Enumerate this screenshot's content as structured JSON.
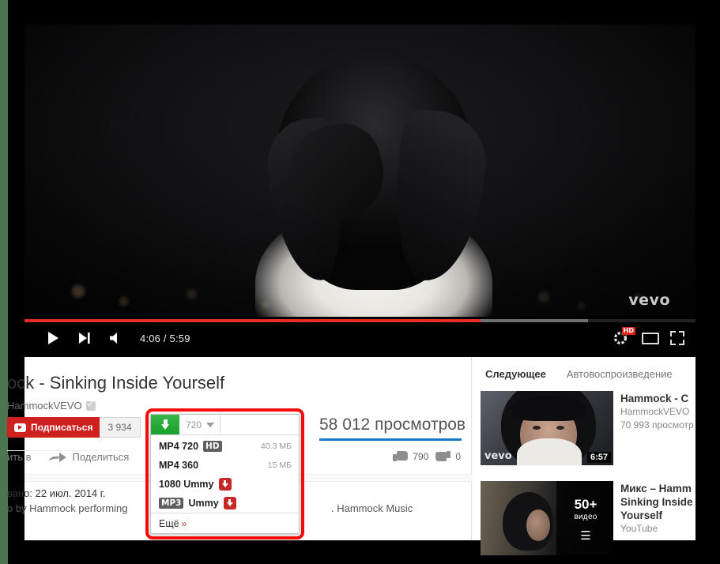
{
  "player": {
    "time_current": "4:06",
    "time_total": "5:59",
    "time_label": "4:06 / 5:59",
    "progress_played_percent": 68,
    "progress_loaded_percent": 84,
    "watermark": "vevo",
    "hd_badge": "HD",
    "icons": {
      "play": "play-icon",
      "next": "next-icon",
      "volume": "volume-icon",
      "settings": "gear-icon",
      "theater": "theater-mode-icon",
      "fullscreen": "fullscreen-icon"
    }
  },
  "video": {
    "title": "ock - Sinking Inside Yourself",
    "channel": "HammockVEVO",
    "subscribe_label": "Подписаться",
    "subscriber_count": "3 934",
    "views": "58 012 просмотров",
    "likes": "790",
    "dislikes": "0",
    "add_to_label": "ить в",
    "share_label": "Поделиться",
    "published_line": "вано: 22 июл. 2014 г.",
    "description_line": "o by Hammock performing",
    "description_line_right": ". Hammock Music"
  },
  "download_panel": {
    "selected_quality": "720",
    "items": [
      {
        "label": "MP4 720",
        "tag": "HD",
        "tag_type": "hd",
        "size": "40.3 МБ",
        "has_red_icon": false
      },
      {
        "label": "MP4 360",
        "tag": "",
        "tag_type": "",
        "size": "15 МБ",
        "has_red_icon": false
      },
      {
        "label": "1080 Ummy",
        "tag": "",
        "tag_type": "",
        "size": "",
        "has_red_icon": true
      },
      {
        "label": "Ummy",
        "tag": "MP3",
        "tag_type": "mp3",
        "size": "",
        "has_red_icon": true
      }
    ],
    "more_label": "Ещё",
    "more_chevron": "»",
    "highlight_color": "#f50c0c",
    "button_color": "#17a02e"
  },
  "sidebar": {
    "tabs": [
      {
        "label": "Следующее",
        "active": true
      },
      {
        "label": "Автовоспроизведение",
        "active": false
      }
    ],
    "suggestions": [
      {
        "title": "Hammock - C",
        "channel": "HammockVEVO",
        "views": "70 993 просмотр",
        "duration": "6:57",
        "badge": "vevo"
      },
      {
        "title_lines": [
          "Микс – Hamm",
          "Sinking Inside",
          "Yourself"
        ],
        "channel": "YouTube",
        "mix_count": "50+",
        "mix_word": "видео"
      }
    ]
  }
}
